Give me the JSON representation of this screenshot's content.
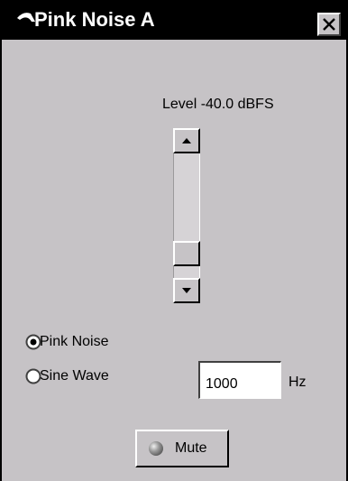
{
  "window": {
    "title": "Pink Noise A"
  },
  "level": {
    "label": "Level -40.0 dBFS",
    "slider_fraction": 0.88
  },
  "signal_type": {
    "options": [
      {
        "label": "Pink Noise",
        "selected": true
      },
      {
        "label": "Sine Wave",
        "selected": false
      }
    ]
  },
  "frequency": {
    "value": "1000",
    "unit": "Hz"
  },
  "mute": {
    "label": "Mute",
    "active": false
  },
  "colors": {
    "panel": "#c6c3c6",
    "titlebar": "#000000",
    "title_text": "#ffffff"
  },
  "icons": {
    "title": "app-swoosh-icon",
    "close": "close-icon",
    "up": "arrow-up-icon",
    "down": "arrow-down-icon",
    "led": "led-indicator-icon"
  }
}
